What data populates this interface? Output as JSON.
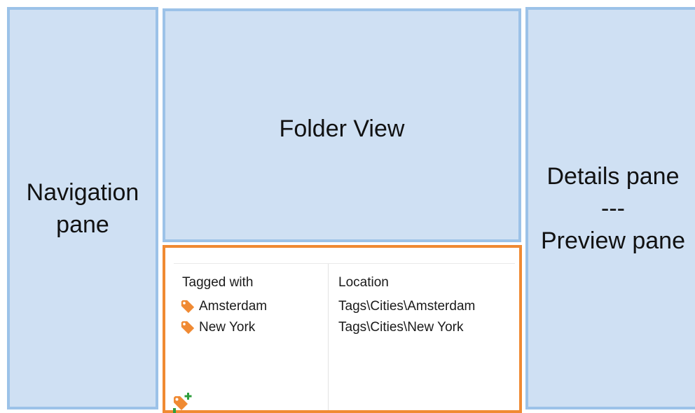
{
  "panes": {
    "navigation": {
      "line1": "Navigation",
      "line2": "pane"
    },
    "folder_view": {
      "label": "Folder View"
    },
    "details": {
      "line1": "Details pane",
      "separator": "---",
      "line2": "Preview pane"
    }
  },
  "tags_panel": {
    "tagged_with_header": "Tagged with",
    "location_header": "Location",
    "rows": [
      {
        "tag": "Amsterdam",
        "location": "Tags\\Cities\\Amsterdam"
      },
      {
        "tag": "New York",
        "location": "Tags\\Cities\\New York"
      }
    ],
    "tag_icon": "tag-icon",
    "add_icon": "add-tag-icon",
    "colors": {
      "accent": "#f08a33",
      "pane_fill": "#cfe0f3",
      "pane_border": "#9cc2e8"
    }
  }
}
